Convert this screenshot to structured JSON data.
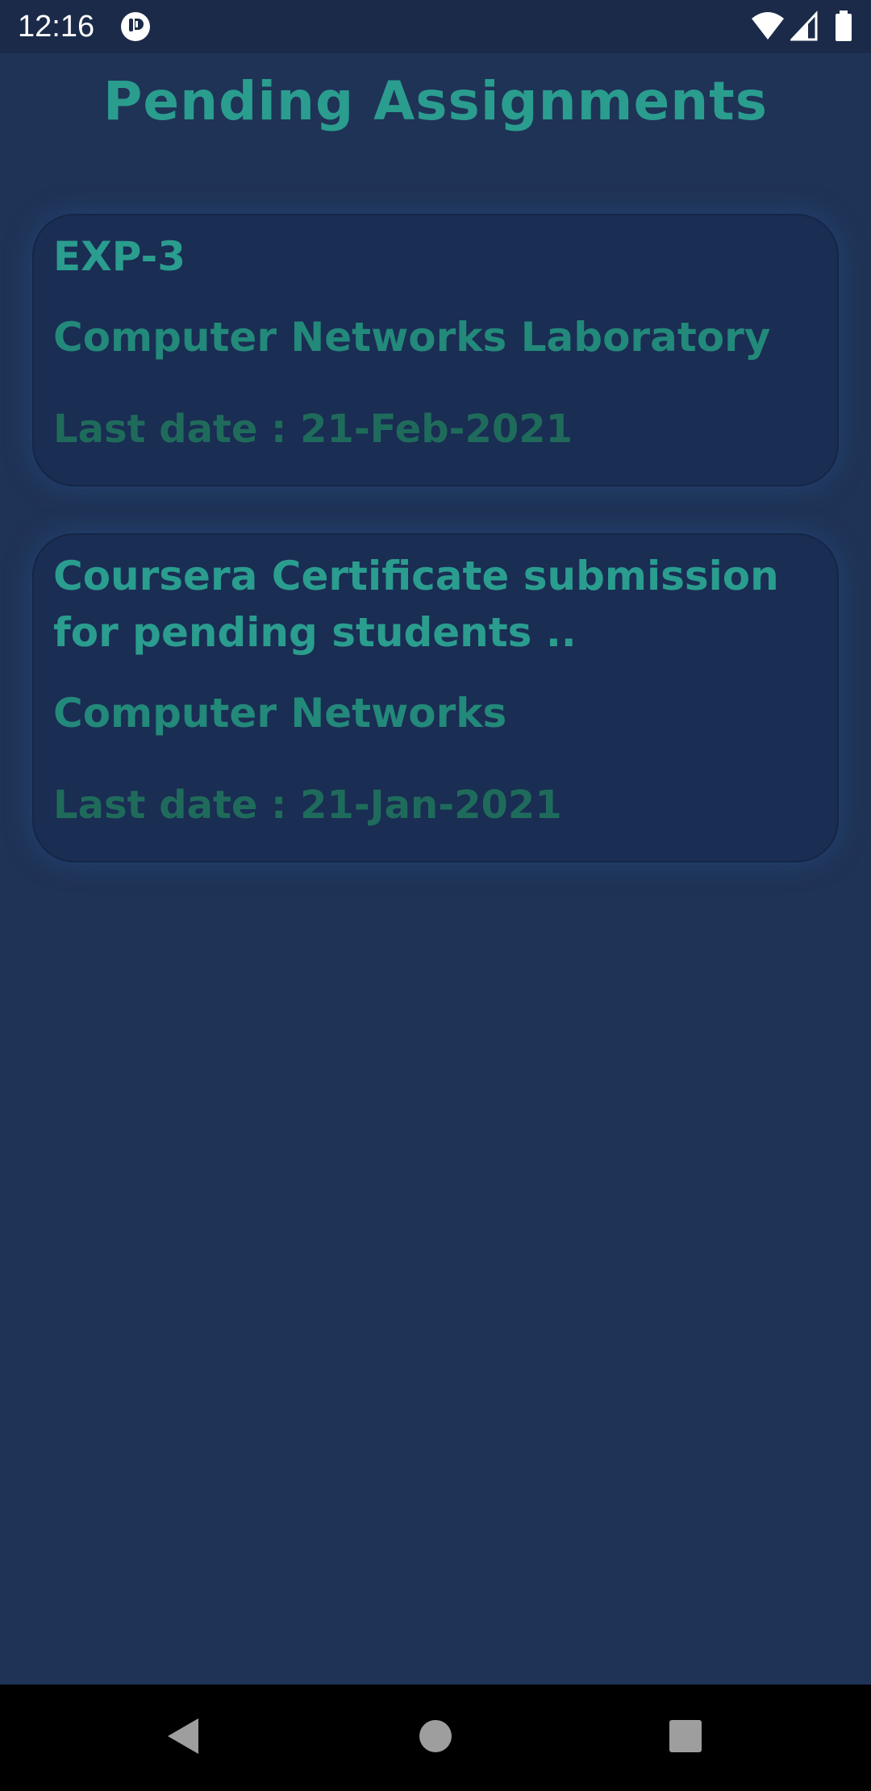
{
  "status_bar": {
    "time": "12:16",
    "icons": [
      "app-notification-icon",
      "wifi-icon",
      "cell-signal-icon",
      "battery-icon"
    ]
  },
  "page": {
    "title": "Pending Assignments"
  },
  "assignments": [
    {
      "title": "EXP-3",
      "subject": "Computer Networks Laboratory",
      "last_date": "Last date : 21-Feb-2021"
    },
    {
      "title": "Coursera Certificate submission for pending students ..",
      "subject": "Computer Networks",
      "last_date": "Last date : 21-Jan-2021"
    }
  ],
  "nav_bar": {
    "icons": [
      "back-icon",
      "home-icon",
      "recents-icon"
    ]
  },
  "colors": {
    "background": "#1f3356",
    "card": "#1a2d53",
    "accent": "#2a9d8f",
    "subject": "#23897a",
    "date": "#1f6b5b"
  }
}
